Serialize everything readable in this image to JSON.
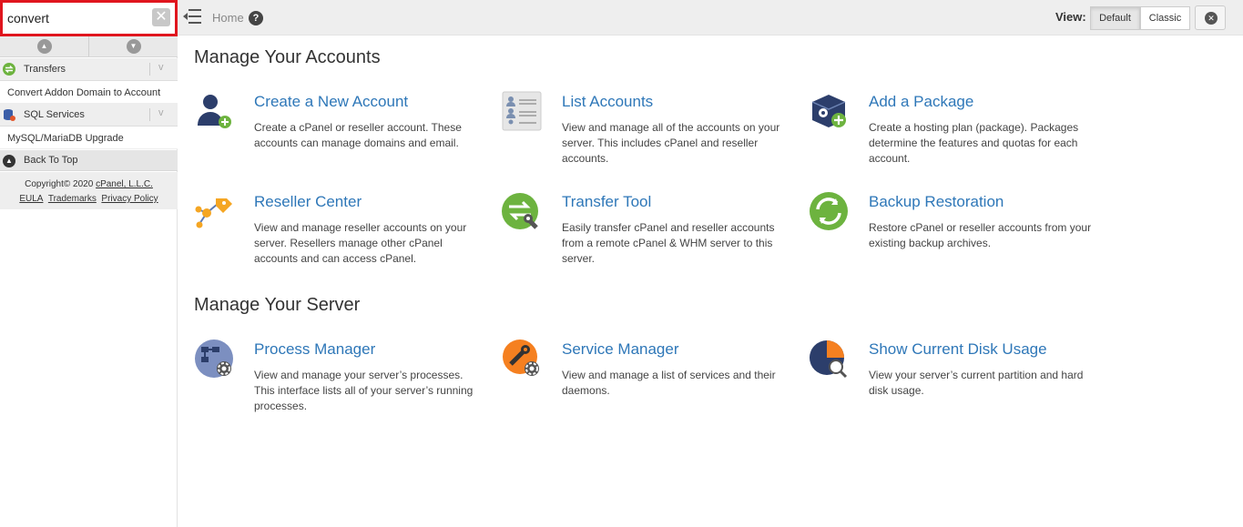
{
  "sidebar": {
    "search": {
      "value": "convert",
      "clear_label": "✕"
    },
    "categories": [
      {
        "label": "Transfers",
        "icon": "transfers-icon",
        "items": [
          "Convert Addon Domain to Account"
        ]
      },
      {
        "label": "SQL Services",
        "icon": "sql-services-icon",
        "items": [
          "MySQL/MariaDB Upgrade"
        ]
      }
    ],
    "back_to_top": "Back To Top",
    "footer": {
      "copyright": "Copyright© 2020",
      "company": "cPanel, L.L.C.",
      "links": [
        "EULA",
        "Trademarks",
        "Privacy Policy"
      ]
    }
  },
  "topbar": {
    "home": "Home",
    "help_icon": "?",
    "view_label": "View:",
    "view_options": [
      "Default",
      "Classic"
    ],
    "selected_view": "Default"
  },
  "sections": [
    {
      "title": "Manage Your Accounts",
      "items": [
        {
          "title": "Create a New Account",
          "icon": "create-account-icon",
          "desc": "Create a cPanel or reseller account. These accounts can manage domains and email."
        },
        {
          "title": "List Accounts",
          "icon": "list-accounts-icon",
          "desc": "View and manage all of the accounts on your server. This includes cPanel and reseller accounts."
        },
        {
          "title": "Add a Package",
          "icon": "add-package-icon",
          "desc": "Create a hosting plan (package). Packages determine the features and quotas for each account."
        },
        {
          "title": "Reseller Center",
          "icon": "reseller-center-icon",
          "desc": "View and manage reseller accounts on your server. Resellers manage other cPanel accounts and can access cPanel."
        },
        {
          "title": "Transfer Tool",
          "icon": "transfer-tool-icon",
          "desc": "Easily transfer cPanel and reseller accounts from a remote cPanel & WHM server to this server."
        },
        {
          "title": "Backup Restoration",
          "icon": "backup-restoration-icon",
          "desc": "Restore cPanel or reseller accounts from your existing backup archives."
        }
      ]
    },
    {
      "title": "Manage Your Server",
      "items": [
        {
          "title": "Process Manager",
          "icon": "process-manager-icon",
          "desc": "View and manage your server’s processes. This interface lists all of your server’s running processes."
        },
        {
          "title": "Service Manager",
          "icon": "service-manager-icon",
          "desc": "View and manage a list of services and their daemons."
        },
        {
          "title": "Show Current Disk Usage",
          "icon": "disk-usage-icon",
          "desc": "View your server’s current partition and hard disk usage."
        }
      ]
    }
  ],
  "colors": {
    "link": "#2e77b8",
    "highlight": "#e0161e",
    "green": "#6db33f",
    "orange": "#f58020",
    "navy": "#2c3e6b"
  }
}
